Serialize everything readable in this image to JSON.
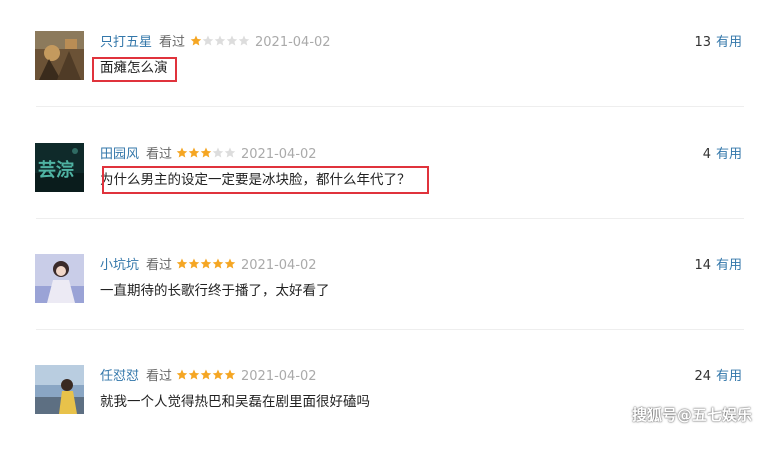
{
  "reviews": [
    {
      "user": "只打五星",
      "action": "看过",
      "rating": 1,
      "date": "2021-04-02",
      "votes": "13",
      "useful_label": "有用",
      "comment": "面瘫怎么演",
      "highlighted": true
    },
    {
      "user": "田园风",
      "action": "看过",
      "rating": 3,
      "date": "2021-04-02",
      "votes": "4",
      "useful_label": "有用",
      "comment": "为什么男主的设定一定要是冰块脸，都什么年代了？",
      "highlighted": true
    },
    {
      "user": "小坑坑",
      "action": "看过",
      "rating": 5,
      "date": "2021-04-02",
      "votes": "14",
      "useful_label": "有用",
      "comment": "一直期待的长歌行终于播了，太好看了",
      "highlighted": false
    },
    {
      "user": "任怼怼",
      "action": "看过",
      "rating": 5,
      "date": "2021-04-02",
      "votes": "24",
      "useful_label": "有用",
      "comment": "就我一个人觉得热巴和吴磊在剧里面很好磕吗",
      "highlighted": false
    }
  ],
  "star_colors": {
    "filled": "#f5a623",
    "empty": "#dddddd"
  },
  "highlight_color": "#e0333c",
  "link_color": "#3377aa",
  "watermark": "搜狐号@五七娱乐"
}
